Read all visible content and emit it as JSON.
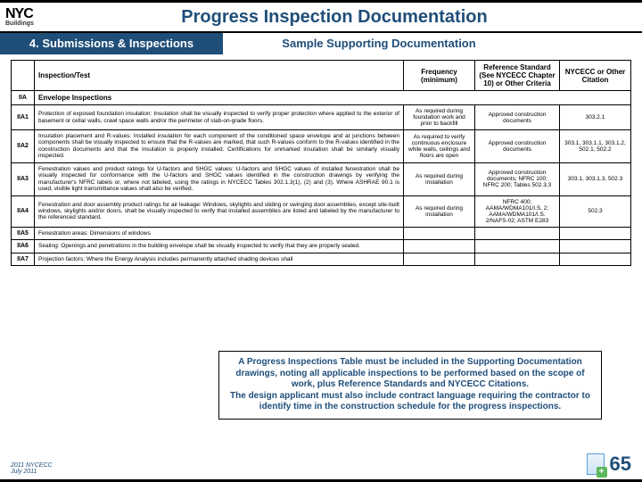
{
  "header": {
    "logo_main": "NYC",
    "logo_sub": "Buildings",
    "title": "Progress Inspection Documentation"
  },
  "subheader": {
    "breadcrumb": "4. Submissions & Inspections",
    "subtitle": "Sample Supporting Documentation"
  },
  "table": {
    "head": {
      "c0": "",
      "c1": "Inspection/Test",
      "c2": "Frequency (minimum)",
      "c3": "Reference Standard (See NYCECC Chapter 10) or Other Criteria",
      "c4": "NYCECC or Other Citation"
    },
    "group": {
      "id": "IIA",
      "name": "Envelope Inspections"
    },
    "rows": [
      {
        "id": "IIA1",
        "desc": "Protection of exposed foundation insulation: Insulation shall be visually inspected to verify proper protection where applied to the exterior of basement or cellar walls, crawl space walls and/or the perimeter of slab-on-grade floors.",
        "freq": "As required during foundation work and prior to backfill",
        "ref": "Approved construction documents",
        "cite": "303.2.1"
      },
      {
        "id": "IIA2",
        "desc": "Insulation placement and R-values: Installed insulation for each component of the conditioned space envelope and at junctions between components shall be visually inspected to ensure that the R-values are marked, that such R-values conform to the R-values identified in the construction documents and that the insulation is properly installed. Certifications for unmarked insulation shall be similarly visually inspected.",
        "freq": "As required to verify continuous enclosure while walls, ceilings and floors are open",
        "ref": "Approved construction documents",
        "cite": "303.1, 303.1.1, 303.1.2, 502.1, 502.2"
      },
      {
        "id": "IIA3",
        "desc": "Fenestration values and product ratings for U-factors and SHGC values: U-factors and SHGC values of installed fenestration shall be visually inspected for conformance with the U-factors and SHGC values identified in the construction drawings by verifying the manufacturer's NFRC labels or, where not labeled, using the ratings in NYCECC Tables 302.1.3(1), (2) and (3). Where ASHRAE 90.1 is used, visible light transmittance values shall also be verified.",
        "freq": "As required during installation",
        "ref": "Approved construction documents; NFRC 100; NFRC 200; Tables 502.3.3",
        "cite": "303.1, 303.1.3, 502.3"
      },
      {
        "id": "IIA4",
        "desc": "Fenestration and door assembly product ratings for air leakage: Windows, skylights and sliding or swinging door assemblies, except site-built windows, skylights and/or doors, shall be visually inspected to verify that installed assemblies are listed and labeled by the manufacturer to the referenced standard.",
        "freq": "As required during installation",
        "ref": "NFRC 400; AAMA/WDMA101/I.S. 2; AAMA/WDMA101/I.S. 2/NAFS-02; ASTM E283",
        "cite": "502.3"
      },
      {
        "id": "IIA5",
        "desc": "Fenestration areas: Dimensions of windows",
        "freq": "",
        "ref": "",
        "cite": ""
      },
      {
        "id": "IIA6",
        "desc": "Sealing: Openings and penetrations in the building envelope shall be visually inspected to verify that they are properly sealed.",
        "freq": "",
        "ref": "",
        "cite": ""
      },
      {
        "id": "IIA7",
        "desc": "Projection factors: Where the Energy Analysis includes permanently attached shading devices shall",
        "freq": "",
        "ref": "",
        "cite": ""
      }
    ]
  },
  "overlay": {
    "l1": "A Progress Inspections Table must be included in the Supporting Documentation drawings, noting all applicable inspections to be performed based on the scope of work, plus Reference Standards and NYCECC Citations.",
    "l2": "The design applicant must also include contract language requiring the contractor to identify time in the construction schedule for the progress inspections."
  },
  "footer": {
    "left_l1": "2011 NYCECC",
    "left_l2": "July 2011",
    "page": "65"
  }
}
